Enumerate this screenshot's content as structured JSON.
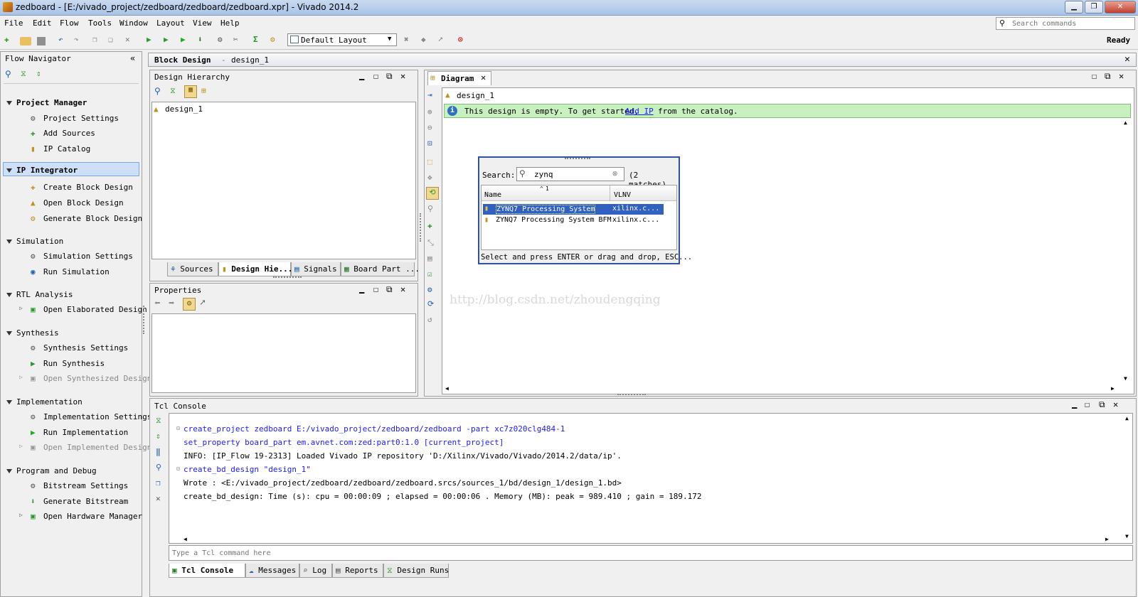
{
  "window": {
    "title": "zedboard - [E:/vivado_project/zedboard/zedboard/zedboard.xpr] - Vivado 2014.2",
    "min": "▁",
    "max": "❐",
    "close": "✕"
  },
  "menu": [
    "File",
    "Edit",
    "Flow",
    "Tools",
    "Window",
    "Layout",
    "View",
    "Help"
  ],
  "search_commands_placeholder": "Search commands",
  "layout_select": "Default Layout",
  "status": "Ready",
  "flow_navigator": {
    "title": "Flow Navigator",
    "sections": [
      {
        "label": "Project Manager",
        "items": [
          "Project Settings",
          "Add Sources",
          "IP Catalog"
        ]
      },
      {
        "label": "IP Integrator",
        "items": [
          "Create Block Design",
          "Open Block Design",
          "Generate Block Design"
        ]
      },
      {
        "label": "Simulation",
        "items": [
          "Simulation Settings",
          "Run Simulation"
        ]
      },
      {
        "label": "RTL Analysis",
        "items": [
          "Open Elaborated Design"
        ]
      },
      {
        "label": "Synthesis",
        "items": [
          "Synthesis Settings",
          "Run Synthesis",
          "Open Synthesized Design"
        ]
      },
      {
        "label": "Implementation",
        "items": [
          "Implementation Settings",
          "Run Implementation",
          "Open Implemented Design"
        ]
      },
      {
        "label": "Program and Debug",
        "items": [
          "Bitstream Settings",
          "Generate Bitstream",
          "Open Hardware Manager"
        ]
      }
    ]
  },
  "block_design": {
    "title": "Block Design",
    "sep": "-",
    "name": "design_1"
  },
  "hierarchy": {
    "title": "Design Hierarchy",
    "root": "design_1",
    "tabs": [
      "Sources",
      "Design Hie...",
      "Signals",
      "Board Part ..."
    ]
  },
  "properties": {
    "title": "Properties"
  },
  "diagram": {
    "tab": "Diagram",
    "design": "design_1",
    "info_pre": "This design is empty. To get started,",
    "info_link": "Add IP",
    "info_post": "from the catalog.",
    "watermark": "http://blog.csdn.net/zhoudengqing"
  },
  "ip_search": {
    "label": "Search:",
    "value": "zynq",
    "matches": "(2 matches)",
    "col_name": "Name",
    "col_vlnv": "VLNV",
    "sort_marker": "1",
    "rows": [
      {
        "name": "ZYNQ7 Processing System",
        "vlnv": "xilinx.c..."
      },
      {
        "name": "ZYNQ7 Processing System BFM",
        "vlnv": "xilinx.c..."
      }
    ],
    "footer": "Select and press ENTER or drag and drop, ESC..."
  },
  "tcl": {
    "title": "Tcl Console",
    "lines": [
      {
        "text": "create_project zedboard E:/vivado_project/zedboard/zedboard -part xc7z020clg484-1",
        "cmd": true
      },
      {
        "text": "set_property board_part em.avnet.com:zed:part0:1.0 [current_project]",
        "cmd": true
      },
      {
        "text": "INFO: [IP_Flow 19-2313] Loaded Vivado IP repository 'D:/Xilinx/Vivado/Vivado/2014.2/data/ip'.",
        "cmd": false
      },
      {
        "text": "create_bd_design \"design_1\"",
        "cmd": true
      },
      {
        "text": "Wrote  : <E:/vivado_project/zedboard/zedboard/zedboard.srcs/sources_1/bd/design_1/design_1.bd>",
        "cmd": false
      },
      {
        "text": "create_bd_design: Time (s): cpu = 00:00:09 ; elapsed = 00:00:06 . Memory (MB): peak = 989.410 ; gain = 189.172",
        "cmd": false
      }
    ],
    "input_placeholder": "Type a Tcl command here",
    "tabs": [
      "Tcl Console",
      "Messages",
      "Log",
      "Reports",
      "Design Runs"
    ]
  },
  "colors": {
    "accent": "#316ac5",
    "info_bg": "#c8f0c0",
    "selected_nav": "#cde0f7"
  }
}
